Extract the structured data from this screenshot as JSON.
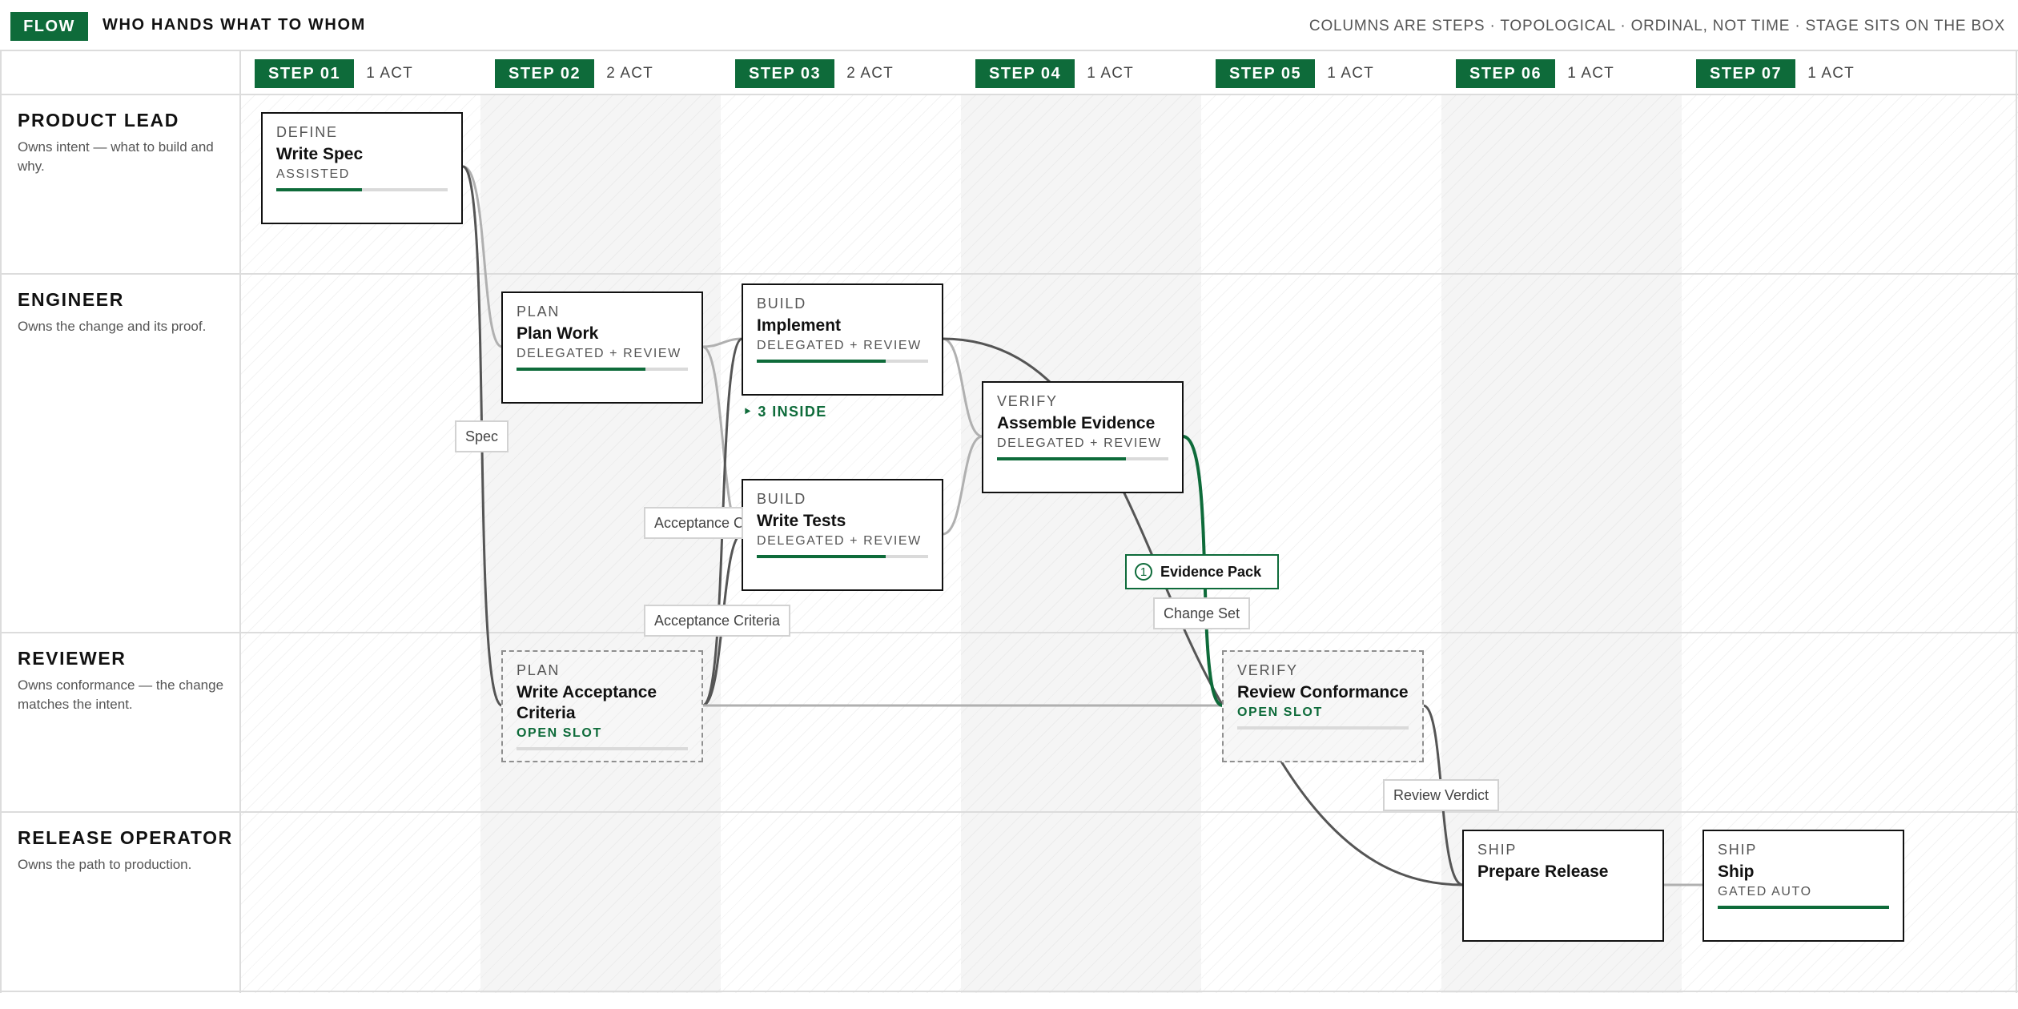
{
  "header": {
    "badge": "FLOW",
    "title": "WHO HANDS WHAT TO WHOM",
    "subtitle": "COLUMNS ARE STEPS · TOPOLOGICAL · ORDINAL, NOT TIME · STAGE SITS ON THE BOX"
  },
  "steps": [
    {
      "label": "STEP 01",
      "count": "1 ACT"
    },
    {
      "label": "STEP 02",
      "count": "2 ACT"
    },
    {
      "label": "STEP 03",
      "count": "2 ACT"
    },
    {
      "label": "STEP 04",
      "count": "1 ACT"
    },
    {
      "label": "STEP 05",
      "count": "1 ACT"
    },
    {
      "label": "STEP 06",
      "count": "1 ACT"
    },
    {
      "label": "STEP 07",
      "count": "1 ACT"
    }
  ],
  "lanes": [
    {
      "name": "PRODUCT LEAD",
      "desc": "Owns intent — what to build and why."
    },
    {
      "name": "ENGINEER",
      "desc": "Owns the change and its proof."
    },
    {
      "name": "REVIEWER",
      "desc": "Owns conformance — the change matches the intent."
    },
    {
      "name": "RELEASE OPERATOR",
      "desc": "Owns the path to production."
    }
  ],
  "nodes": [
    {
      "stage": "DEFINE",
      "title": "Write Spec",
      "mode": "ASSISTED",
      "progress": 0.5
    },
    {
      "stage": "PLAN",
      "title": "Plan Work",
      "mode": "DELEGATED + REVIEW",
      "progress": 0.75
    },
    {
      "stage": "BUILD",
      "title": "Implement",
      "mode": "DELEGATED + REVIEW",
      "progress": 0.75
    },
    {
      "stage": "BUILD",
      "title": "Write Tests",
      "mode": "DELEGATED + REVIEW",
      "progress": 0.75
    },
    {
      "stage": "VERIFY",
      "title": "Assemble Evidence",
      "mode": "DELEGATED + REVIEW",
      "progress": 0.75
    },
    {
      "stage": "PLAN",
      "title": "Write Acceptance Criteria",
      "mode": "OPEN SLOT",
      "progress": 0
    },
    {
      "stage": "VERIFY",
      "title": "Review Conformance",
      "mode": "OPEN SLOT",
      "progress": 0
    },
    {
      "stage": "SHIP",
      "title": "Prepare Release",
      "mode": "",
      "progress": null
    },
    {
      "stage": "SHIP",
      "title": "Ship",
      "mode": "GATED AUTO",
      "progress": 1
    }
  ],
  "inside_label": "‣ 3 INSIDE",
  "edge_labels": {
    "spec": "Spec",
    "acceptance_1": "Acceptance Criteria",
    "acceptance_2": "Acceptance Criteria",
    "change_set": "Change Set",
    "review_verdict": "Review Verdict"
  },
  "artifact": {
    "number": "1",
    "label": "Evidence Pack"
  },
  "colors": {
    "accent": "#0e6b3a",
    "edge": "#555555",
    "edge_light": "#b0b0b0",
    "grid": "#dcdcdc"
  }
}
